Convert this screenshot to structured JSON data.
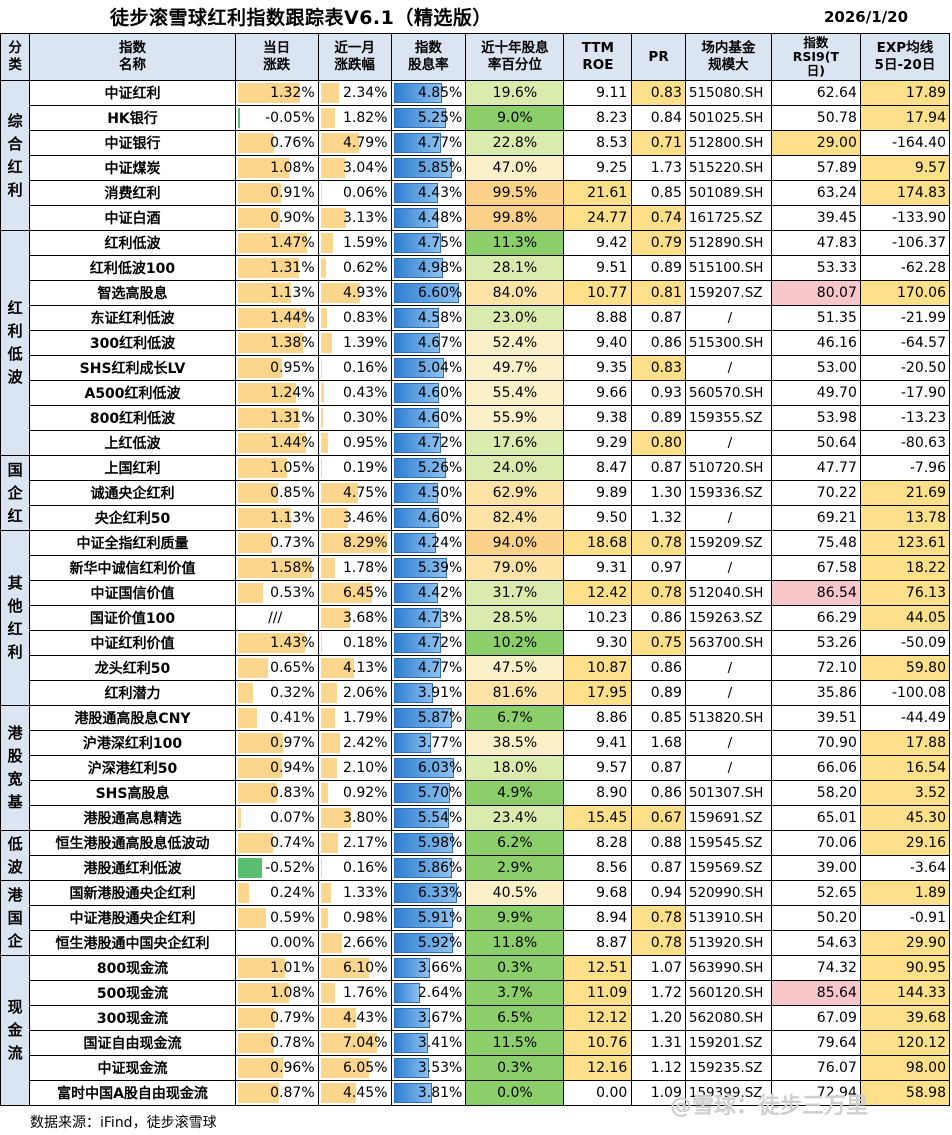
{
  "header": {
    "title": "徒步滚雪球红利指数跟踪表V6.1（精选版）",
    "date": "2026/1/20"
  },
  "columns": {
    "cat": "分\n类",
    "name": "指数\n名称",
    "day": "当日\n涨跌",
    "month": "近一月\n涨跌幅",
    "dy": "指数\n股息率",
    "pct": "近十年股息\n率百分位",
    "roe": "TTM\nROE",
    "pr": "PR",
    "fund": "场内基金\n规模大",
    "rsi": "指数\nRSI9(T\n日)",
    "exp": "EXP均线\n5日-20日"
  },
  "groups": [
    {
      "label": "综合红利",
      "rows": [
        {
          "name": "中证红利",
          "day": "1.32%",
          "month": "2.34%",
          "dy": "4.85%",
          "pct": "19.6%",
          "roe": "9.11",
          "pr": "0.83",
          "fund": "515080.SH",
          "rsi": "62.64",
          "exp": "17.89"
        },
        {
          "name": "HK银行",
          "day": "-0.05%",
          "month": "1.82%",
          "dy": "5.25%",
          "pct": "9.0%",
          "roe": "8.23",
          "pr": "0.84",
          "fund": "501025.SH",
          "rsi": "50.78",
          "exp": "17.94"
        },
        {
          "name": "中证银行",
          "day": "0.76%",
          "month": "4.79%",
          "dy": "4.77%",
          "pct": "22.8%",
          "roe": "8.53",
          "pr": "0.71",
          "fund": "512800.SH",
          "rsi": "29.00",
          "exp": "-164.40"
        },
        {
          "name": "中证煤炭",
          "day": "1.08%",
          "month": "3.04%",
          "dy": "5.85%",
          "pct": "47.0%",
          "roe": "9.25",
          "pr": "1.73",
          "fund": "515220.SH",
          "rsi": "57.89",
          "exp": "9.57"
        },
        {
          "name": "消费红利",
          "day": "0.91%",
          "month": "0.06%",
          "dy": "4.43%",
          "pct": "99.5%",
          "roe": "21.61",
          "pr": "0.85",
          "fund": "501089.SH",
          "rsi": "63.24",
          "exp": "174.83"
        },
        {
          "name": "中证白酒",
          "day": "0.90%",
          "month": "3.13%",
          "dy": "4.48%",
          "pct": "99.8%",
          "roe": "24.77",
          "pr": "0.74",
          "fund": "161725.SZ",
          "rsi": "39.45",
          "exp": "-133.90"
        }
      ]
    },
    {
      "label": "红利低波",
      "rows": [
        {
          "name": "红利低波",
          "day": "1.47%",
          "month": "1.59%",
          "dy": "4.75%",
          "pct": "11.3%",
          "roe": "9.42",
          "pr": "0.79",
          "fund": "512890.SH",
          "rsi": "47.83",
          "exp": "-106.37"
        },
        {
          "name": "红利低波100",
          "day": "1.31%",
          "month": "0.62%",
          "dy": "4.98%",
          "pct": "28.1%",
          "roe": "9.51",
          "pr": "0.89",
          "fund": "515100.SH",
          "rsi": "53.33",
          "exp": "-62.28"
        },
        {
          "name": "智选高股息",
          "day": "1.13%",
          "month": "4.93%",
          "dy": "6.60%",
          "pct": "84.0%",
          "roe": "10.77",
          "pr": "0.81",
          "fund": "159207.SZ",
          "rsi": "80.07",
          "exp": "170.06"
        },
        {
          "name": "东证红利低波",
          "day": "1.44%",
          "month": "0.83%",
          "dy": "4.58%",
          "pct": "23.0%",
          "roe": "8.88",
          "pr": "0.87",
          "fund": "/",
          "rsi": "51.35",
          "exp": "-21.99"
        },
        {
          "name": "300红利低波",
          "day": "1.38%",
          "month": "1.39%",
          "dy": "4.67%",
          "pct": "52.4%",
          "roe": "9.40",
          "pr": "0.86",
          "fund": "515300.SH",
          "rsi": "46.16",
          "exp": "-64.57"
        },
        {
          "name": "SHS红利成长LV",
          "day": "0.95%",
          "month": "0.16%",
          "dy": "5.04%",
          "pct": "49.7%",
          "roe": "9.35",
          "pr": "0.83",
          "fund": "/",
          "rsi": "53.00",
          "exp": "-20.50"
        },
        {
          "name": "A500红利低波",
          "day": "1.24%",
          "month": "0.43%",
          "dy": "4.60%",
          "pct": "55.4%",
          "roe": "9.66",
          "pr": "0.93",
          "fund": "560570.SH",
          "rsi": "49.70",
          "exp": "-17.90"
        },
        {
          "name": "800红利低波",
          "day": "1.31%",
          "month": "0.30%",
          "dy": "4.60%",
          "pct": "55.9%",
          "roe": "9.38",
          "pr": "0.89",
          "fund": "159355.SZ",
          "rsi": "53.98",
          "exp": "-13.23"
        },
        {
          "name": "上红低波",
          "day": "1.44%",
          "month": "0.95%",
          "dy": "4.72%",
          "pct": "17.6%",
          "roe": "9.29",
          "pr": "0.80",
          "fund": "/",
          "rsi": "50.64",
          "exp": "-80.63"
        }
      ]
    },
    {
      "label": "国企红",
      "rows": [
        {
          "name": "上国红利",
          "day": "1.05%",
          "month": "0.19%",
          "dy": "5.26%",
          "pct": "24.0%",
          "roe": "8.47",
          "pr": "0.87",
          "fund": "510720.SH",
          "rsi": "47.77",
          "exp": "-7.96"
        },
        {
          "name": "诚通央企红利",
          "day": "0.85%",
          "month": "4.75%",
          "dy": "4.50%",
          "pct": "62.9%",
          "roe": "9.89",
          "pr": "1.30",
          "fund": "159336.SZ",
          "rsi": "70.22",
          "exp": "21.69"
        },
        {
          "name": "央企红利50",
          "day": "1.13%",
          "month": "3.46%",
          "dy": "4.60%",
          "pct": "82.4%",
          "roe": "9.50",
          "pr": "1.32",
          "fund": "/",
          "rsi": "69.21",
          "exp": "13.78"
        }
      ]
    },
    {
      "label": "其他红利",
      "rows": [
        {
          "name": "中证全指红利质量",
          "day": "0.73%",
          "month": "8.29%",
          "dy": "4.24%",
          "pct": "94.0%",
          "roe": "18.68",
          "pr": "0.78",
          "fund": "159209.SZ",
          "rsi": "75.48",
          "exp": "123.61"
        },
        {
          "name": "新华中诚信红利价值",
          "day": "1.58%",
          "month": "1.78%",
          "dy": "5.39%",
          "pct": "79.0%",
          "roe": "9.31",
          "pr": "0.97",
          "fund": "/",
          "rsi": "67.58",
          "exp": "18.22"
        },
        {
          "name": "中证国信价值",
          "day": "0.53%",
          "month": "6.45%",
          "dy": "4.42%",
          "pct": "31.7%",
          "roe": "12.42",
          "pr": "0.78",
          "fund": "512040.SH",
          "rsi": "86.54",
          "exp": "76.13"
        },
        {
          "name": "国证价值100",
          "day": "///",
          "month": "3.68%",
          "dy": "4.73%",
          "pct": "28.5%",
          "roe": "10.23",
          "pr": "0.86",
          "fund": "159263.SZ",
          "rsi": "66.29",
          "exp": "44.05"
        },
        {
          "name": "中证红利价值",
          "day": "1.43%",
          "month": "0.18%",
          "dy": "4.72%",
          "pct": "10.2%",
          "roe": "9.30",
          "pr": "0.75",
          "fund": "563700.SH",
          "rsi": "53.26",
          "exp": "-50.09"
        },
        {
          "name": "龙头红利50",
          "day": "0.65%",
          "month": "4.13%",
          "dy": "4.77%",
          "pct": "47.5%",
          "roe": "10.87",
          "pr": "0.86",
          "fund": "/",
          "rsi": "72.10",
          "exp": "59.80"
        },
        {
          "name": "红利潜力",
          "day": "0.32%",
          "month": "2.06%",
          "dy": "3.91%",
          "pct": "81.6%",
          "roe": "17.95",
          "pr": "0.89",
          "fund": "/",
          "rsi": "35.86",
          "exp": "-100.08"
        }
      ]
    },
    {
      "label": "港股宽基",
      "rows": [
        {
          "name": "港股通高股息CNY",
          "day": "0.41%",
          "month": "1.79%",
          "dy": "5.87%",
          "pct": "6.7%",
          "roe": "8.86",
          "pr": "0.85",
          "fund": "513820.SH",
          "rsi": "39.51",
          "exp": "-44.49"
        },
        {
          "name": "沪港深红利100",
          "day": "0.97%",
          "month": "2.42%",
          "dy": "3.77%",
          "pct": "38.5%",
          "roe": "9.41",
          "pr": "1.68",
          "fund": "/",
          "rsi": "70.90",
          "exp": "17.88"
        },
        {
          "name": "沪深港红利50",
          "day": "0.94%",
          "month": "2.10%",
          "dy": "6.03%",
          "pct": "18.0%",
          "roe": "9.57",
          "pr": "0.87",
          "fund": "/",
          "rsi": "66.06",
          "exp": "16.54"
        },
        {
          "name": "SHS高股息",
          "day": "0.83%",
          "month": "0.92%",
          "dy": "5.70%",
          "pct": "4.9%",
          "roe": "8.90",
          "pr": "0.86",
          "fund": "501307.SH",
          "rsi": "58.20",
          "exp": "3.52"
        },
        {
          "name": "港股通高息精选",
          "day": "0.07%",
          "month": "3.80%",
          "dy": "5.54%",
          "pct": "23.4%",
          "roe": "15.45",
          "pr": "0.67",
          "fund": "159691.SZ",
          "rsi": "65.01",
          "exp": "45.30"
        }
      ]
    },
    {
      "label": "低波",
      "rows": [
        {
          "name": "恒生港股通高股息低波动",
          "day": "0.74%",
          "month": "2.17%",
          "dy": "5.98%",
          "pct": "6.2%",
          "roe": "8.28",
          "pr": "0.88",
          "fund": "159545.SZ",
          "rsi": "70.06",
          "exp": "29.16"
        },
        {
          "name": "港股通红利低波",
          "day": "-0.52%",
          "month": "0.16%",
          "dy": "5.86%",
          "pct": "2.9%",
          "roe": "8.56",
          "pr": "0.87",
          "fund": "159569.SZ",
          "rsi": "39.00",
          "exp": "-3.64"
        }
      ]
    },
    {
      "label": "港国企",
      "rows": [
        {
          "name": "国新港股通央企红利",
          "day": "0.24%",
          "month": "1.33%",
          "dy": "6.33%",
          "pct": "40.5%",
          "roe": "9.68",
          "pr": "0.94",
          "fund": "520990.SH",
          "rsi": "52.65",
          "exp": "1.89"
        },
        {
          "name": "中证港股通央企红利",
          "day": "0.59%",
          "month": "0.98%",
          "dy": "5.91%",
          "pct": "9.9%",
          "roe": "8.94",
          "pr": "0.78",
          "fund": "513910.SH",
          "rsi": "50.20",
          "exp": "-0.91"
        },
        {
          "name": "恒生港股通中国央企红利",
          "day": "0.00%",
          "month": "2.66%",
          "dy": "5.92%",
          "pct": "11.8%",
          "roe": "8.87",
          "pr": "0.78",
          "fund": "513920.SH",
          "rsi": "54.63",
          "exp": "29.90"
        }
      ]
    },
    {
      "label": "现金流",
      "rows": [
        {
          "name": "800现金流",
          "day": "1.01%",
          "month": "6.10%",
          "dy": "3.66%",
          "pct": "0.3%",
          "roe": "12.51",
          "pr": "1.07",
          "fund": "563990.SH",
          "rsi": "74.32",
          "exp": "90.95"
        },
        {
          "name": "500现金流",
          "day": "1.08%",
          "month": "1.76%",
          "dy": "2.64%",
          "pct": "3.7%",
          "roe": "11.09",
          "pr": "1.72",
          "fund": "560120.SH",
          "rsi": "85.64",
          "exp": "144.33"
        },
        {
          "name": "300现金流",
          "day": "0.79%",
          "month": "4.43%",
          "dy": "3.67%",
          "pct": "6.5%",
          "roe": "12.12",
          "pr": "1.20",
          "fund": "562080.SH",
          "rsi": "67.09",
          "exp": "39.68"
        },
        {
          "name": "国证自由现金流",
          "day": "0.78%",
          "month": "7.04%",
          "dy": "3.41%",
          "pct": "11.5%",
          "roe": "10.76",
          "pr": "1.31",
          "fund": "159201.SZ",
          "rsi": "79.64",
          "exp": "120.12"
        },
        {
          "name": "中证现金流",
          "day": "0.96%",
          "month": "6.05%",
          "dy": "3.53%",
          "pct": "0.3%",
          "roe": "12.16",
          "pr": "1.12",
          "fund": "159235.SZ",
          "rsi": "76.07",
          "exp": "98.00"
        },
        {
          "name": "富时中国A股自由现金流",
          "day": "0.87%",
          "month": "4.45%",
          "dy": "3.81%",
          "pct": "0.0%",
          "roe": "0.00",
          "pr": "1.09",
          "fund": "159399.SZ",
          "rsi": "72.94",
          "exp": "58.98"
        }
      ]
    }
  ],
  "footer": "数据来源：iFind，徒步滚雪球",
  "watermark": "@雪球：徒步三万里",
  "colors": {
    "header_bg": "#dbe5f1",
    "bar_pos": "#fcd68d",
    "bar_neg": "#5cbe71",
    "bar_dy": "#2f7fd2",
    "hot": "#ffe08a",
    "alert": "#f8c7cc"
  }
}
